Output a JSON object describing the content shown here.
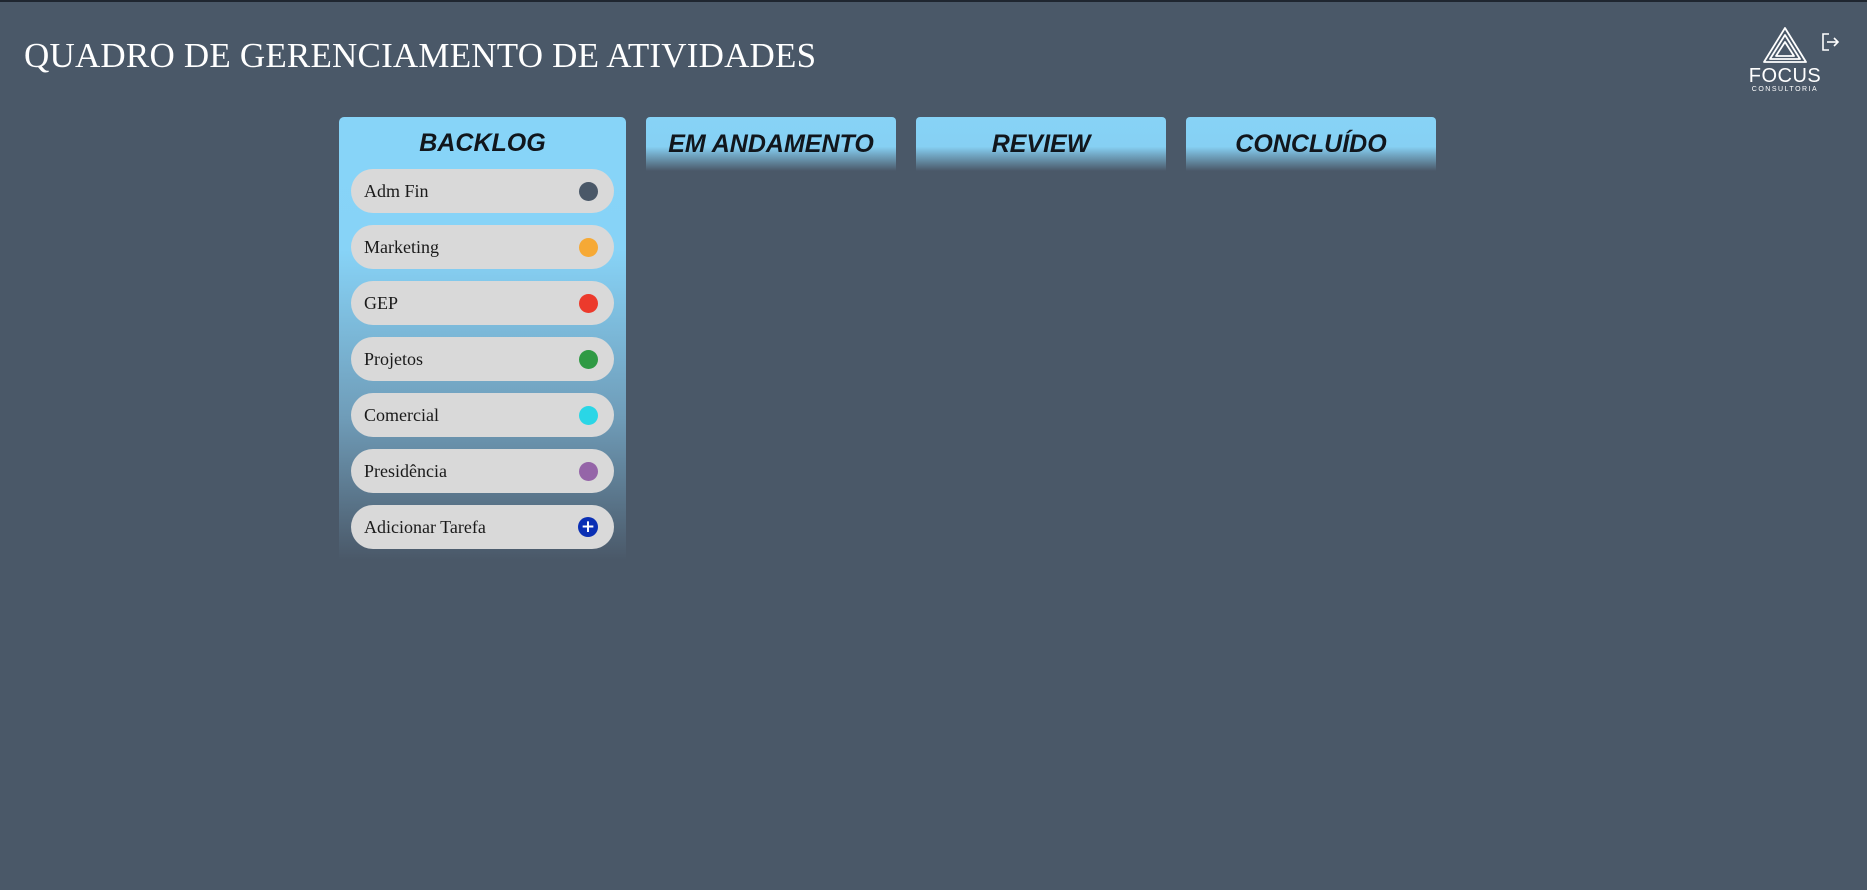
{
  "page": {
    "title": "QUADRO DE GERENCIAMENTO DE ATIVIDADES"
  },
  "logo": {
    "name": "FOCUS",
    "tagline": "CONSULTORIA"
  },
  "columns": [
    {
      "title": "BACKLOG"
    },
    {
      "title": "EM ANDAMENTO"
    },
    {
      "title": "REVIEW"
    },
    {
      "title": "CONCLUÍDO"
    }
  ],
  "backlog": {
    "tasks": [
      {
        "label": "Adm Fin",
        "color": "#4a5868"
      },
      {
        "label": "Marketing",
        "color": "#f6a935"
      },
      {
        "label": "GEP",
        "color": "#ec3a2c"
      },
      {
        "label": "Projetos",
        "color": "#2f9a44"
      },
      {
        "label": "Comercial",
        "color": "#2ad6e6"
      },
      {
        "label": "Presidência",
        "color": "#9565a8"
      }
    ],
    "add_task": {
      "label": "Adicionar Tarefa",
      "icon": "plus-circle-icon",
      "color": "#0a2fb4"
    }
  },
  "colors": {
    "background": "#4a5868",
    "header_accent": "#87d3f7",
    "task_bg": "#d9d9d9"
  }
}
